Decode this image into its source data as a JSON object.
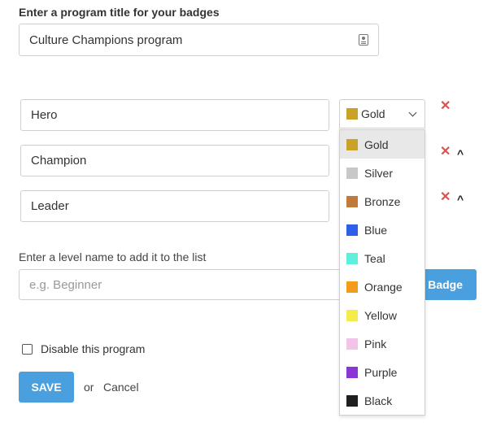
{
  "program": {
    "title_label": "Enter a program title for your badges",
    "title_value": "Culture Champions program"
  },
  "levels": [
    {
      "name": "Hero",
      "remove": "✕"
    },
    {
      "name": "Champion",
      "remove": "✕",
      "move_up": "^"
    },
    {
      "name": "Leader",
      "remove": "✕",
      "move_up": "^"
    }
  ],
  "color_select": {
    "value": "Gold",
    "color": "#c9a227"
  },
  "color_options": [
    {
      "label": "Gold",
      "color": "#c9a227",
      "selected": true
    },
    {
      "label": "Silver",
      "color": "#c8c8c8"
    },
    {
      "label": "Bronze",
      "color": "#c07a3a"
    },
    {
      "label": "Blue",
      "color": "#2f5fe8"
    },
    {
      "label": "Teal",
      "color": "#5ff0dc"
    },
    {
      "label": "Orange",
      "color": "#f59a1c"
    },
    {
      "label": "Yellow",
      "color": "#f4ec4a"
    },
    {
      "label": "Pink",
      "color": "#f2c4e8"
    },
    {
      "label": "Purple",
      "color": "#8a35d6"
    },
    {
      "label": "Black",
      "color": "#1f1f1f"
    }
  ],
  "add_level": {
    "label": "Enter a level name to add it to the list",
    "placeholder": "e.g. Beginner",
    "button_label": "Badge"
  },
  "disable": {
    "label": "Disable this program",
    "checked": false
  },
  "actions": {
    "save_label": "SAVE",
    "or_text": "or",
    "cancel_label": "Cancel"
  },
  "colors": {
    "accent": "#4aa0de",
    "remove": "#d9534f"
  }
}
